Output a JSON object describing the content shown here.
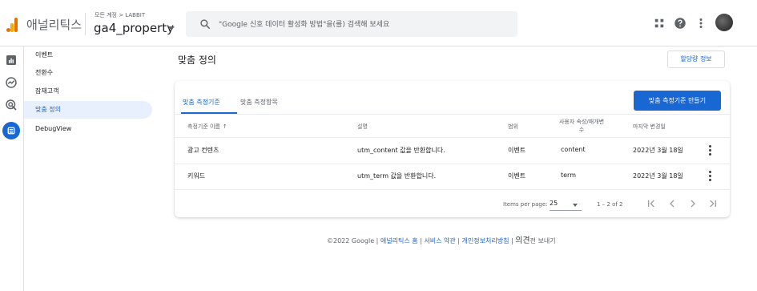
{
  "header": {
    "app_name": "애널리틱스",
    "account_crumb": "모든 계정 > LABBIT",
    "property_name": "ga4_property",
    "search_placeholder": "\"Google 신호 데이터 활성화 방법\"을(를) 검색해 보세요"
  },
  "subnav": {
    "items": [
      {
        "label": "이벤트",
        "active": false
      },
      {
        "label": "전환수",
        "active": false
      },
      {
        "label": "잠재고객",
        "active": false
      },
      {
        "label": "맞춤 정의",
        "active": true
      },
      {
        "label": "DebugView",
        "active": false
      }
    ]
  },
  "main": {
    "title": "맞춤 정의",
    "quota_button": "할당량 정보",
    "tabs": [
      {
        "label": "맞춤 측정기준",
        "active": true
      },
      {
        "label": "맞춤 측정항목",
        "active": false
      }
    ],
    "create_button": "맞춤 측정기준 만들기",
    "columns": {
      "name": "측정기준 이름",
      "name_sort": "↑",
      "description": "설명",
      "scope": "범위",
      "user_property_line1": "사용자 속성/매개변",
      "user_property_line2": "수",
      "last_changed": "마지막 변경일"
    },
    "rows": [
      {
        "name": "광고 컨텐츠",
        "description": "utm_content 값을 반환합니다.",
        "scope": "이벤트",
        "param": "content",
        "last_changed": "2022년 3월 18일"
      },
      {
        "name": "키워드",
        "description": "utm_term 값을 반환합니다.",
        "scope": "이벤트",
        "param": "term",
        "last_changed": "2022년 3월 18일"
      }
    ],
    "pagination": {
      "items_per_page_label": "Items per page:",
      "page_size": "25",
      "range": "1 – 2 of 2"
    }
  },
  "footer": {
    "copyright": "©2022 Google |",
    "home_link": "애널리틱스 홈",
    "sep1": "|",
    "terms_link": "서비스 약관",
    "sep2": "|",
    "privacy_link": "개인정보처리방침",
    "sep3": "|",
    "feedback": "의견",
    "feedback_small": "전 보내기"
  },
  "colors": {
    "accent": "#1967d2",
    "logo_orange": "#e37400",
    "logo_yellow": "#f9ab00"
  },
  "icons": [
    "apps-icon",
    "help-icon",
    "more-vert-icon",
    "search-icon",
    "reports-icon",
    "explore-icon",
    "advertising-icon",
    "configure-icon"
  ]
}
